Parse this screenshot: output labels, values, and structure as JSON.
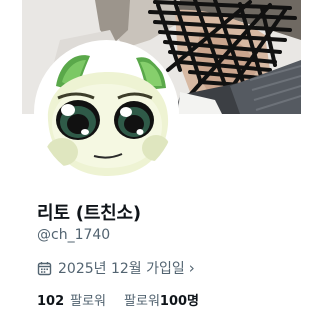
{
  "profile": {
    "display_name": "리토 (트친소)",
    "handle": "@ch_1740",
    "joined_text": "2025년 12월 가입일",
    "joined_chevron": "›",
    "following_count": "102",
    "following_label": "팔로워",
    "followers_label": "팔로워",
    "followers_count": "100명"
  },
  "icons": {
    "calendar": "calendar-icon",
    "chevron": "chevron-right-icon"
  },
  "colors": {
    "text_primary": "#0f1419",
    "text_secondary": "#536471",
    "background": "#ffffff"
  }
}
